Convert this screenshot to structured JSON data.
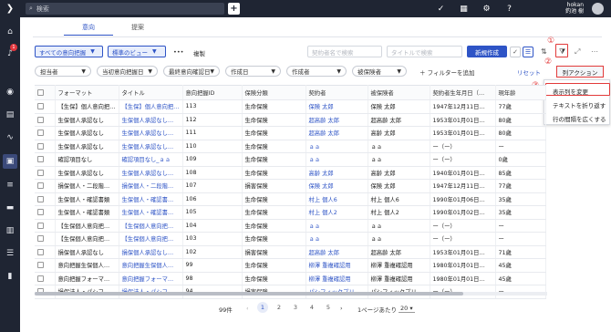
{
  "topbar": {
    "search_placeholder": "検索",
    "add_label": "+",
    "user_company": "hokan",
    "user_name": "釣池 樹"
  },
  "sidebar": {
    "badge_count": "1"
  },
  "tabs": [
    {
      "label": "意向",
      "active": true
    },
    {
      "label": "提案",
      "active": false
    }
  ],
  "toolbar": {
    "view_all": "すべての意向把握",
    "view_standard": "標準のビュー",
    "more": "•••",
    "copy": "複製",
    "contractor_search_placeholder": "契約者名で検索",
    "title_search_placeholder": "タイトルで検索",
    "new_button": "新規作成"
  },
  "filters": {
    "chips": [
      "担当者",
      "当初意向把握日",
      "最終意向確認日",
      "作成日",
      "作成者",
      "被保険者"
    ],
    "add_filter": "フィルターを追加",
    "reset": "リセット"
  },
  "column_action": {
    "label": "列アクション",
    "items": [
      "表示列を変更",
      "テキストを折り返す",
      "行の間隔を広くする"
    ]
  },
  "annotations": [
    "①",
    "②",
    "③"
  ],
  "table": {
    "headers": [
      "",
      "フォーマット",
      "タイトル",
      "意向把握ID",
      "保険分類",
      "契約者",
      "被保険者",
      "契約者生年月日（…",
      "現年齢"
    ],
    "rows": [
      [
        "【生保】個人意向把…",
        "【生保】個人意向把…",
        "113",
        "生命保険",
        "保険 太郎",
        "保険 太郎",
        "1947年12月11日…",
        "77歳"
      ],
      [
        "生保個人承認なし",
        "生保個人承認なし…",
        "112",
        "生命保険",
        "超高齢 太郎",
        "超高齢 太郎",
        "1953年01月01日…",
        "80歳"
      ],
      [
        "生保個人承認なし",
        "生保個人承認なし…",
        "111",
        "生命保険",
        "超高齢 太郎",
        "高齢 太郎",
        "1953年01月01日…",
        "80歳"
      ],
      [
        "生保個人承認なし",
        "生保個人承認なし…",
        "110",
        "生命保険",
        "ａａ",
        "ａａ",
        "ー（ー）",
        "ー"
      ],
      [
        "確認項目なし",
        "確認項目なし_ａａ",
        "109",
        "生命保険",
        "ａａ",
        "ａａ",
        "ー（ー）",
        "0歳"
      ],
      [
        "生保個人承認なし",
        "生保個人承認なし…",
        "108",
        "生命保険",
        "高齢 太郎",
        "高齢 太郎",
        "1940年01月01日…",
        "85歳"
      ],
      [
        "損保個人・二段階…",
        "損保個人・二段階…",
        "107",
        "損害保険",
        "保険 太郎",
        "保険 太郎",
        "1947年12月11日…",
        "77歳"
      ],
      [
        "生保個人・確認書類",
        "生保個人・確認書…",
        "106",
        "生命保険",
        "村上 個人6",
        "村上 個人6",
        "1990年01月06日…",
        "35歳"
      ],
      [
        "生保個人・確認書類",
        "生保個人・確認書…",
        "105",
        "生命保険",
        "村上 個人2",
        "村上 個人2",
        "1990年01月02日…",
        "35歳"
      ],
      [
        "【生保個人意向把…",
        "【生保個人意向把…",
        "104",
        "生命保険",
        "ａａ",
        "ａａ",
        "ー（ー）",
        "ー"
      ],
      [
        "【生保個人意向把…",
        "【生保個人意向把…",
        "103",
        "生命保険",
        "ａａ",
        "ａａ",
        "ー（ー）",
        "ー"
      ],
      [
        "損保個人承認なし",
        "損保個人承認なし…",
        "102",
        "損害保険",
        "超高齢 太郎",
        "超高齢 太郎",
        "1953年01月01日…",
        "71歳"
      ],
      [
        "意向把握生保個人…",
        "意向把握生保個人…",
        "99",
        "生命保険",
        "柳澤 重複確認用",
        "柳澤 重複確認用",
        "1980年01月01日…",
        "45歳"
      ],
      [
        "意向把握フォーマ…",
        "意向把握フォーマ…",
        "98",
        "生命保険",
        "柳澤 重複確認用",
        "柳澤 重複確認用",
        "1980年01月01日…",
        "45歳"
      ],
      [
        "損保法人・パシフ…",
        "損保法人・パシフ…",
        "94",
        "損害保険",
        "パシフィックプリ…",
        "パシフィックプリ…",
        "ー（ー）",
        "ー"
      ]
    ]
  },
  "pagination": {
    "total": "99件",
    "pages": [
      "1",
      "2",
      "3",
      "4",
      "5"
    ],
    "per_page_label": "1ページあたり",
    "per_page_value": "20"
  },
  "colors": {
    "accent": "#2e54c6",
    "topbar": "#1f2533",
    "highlight": "#e23a3a"
  }
}
